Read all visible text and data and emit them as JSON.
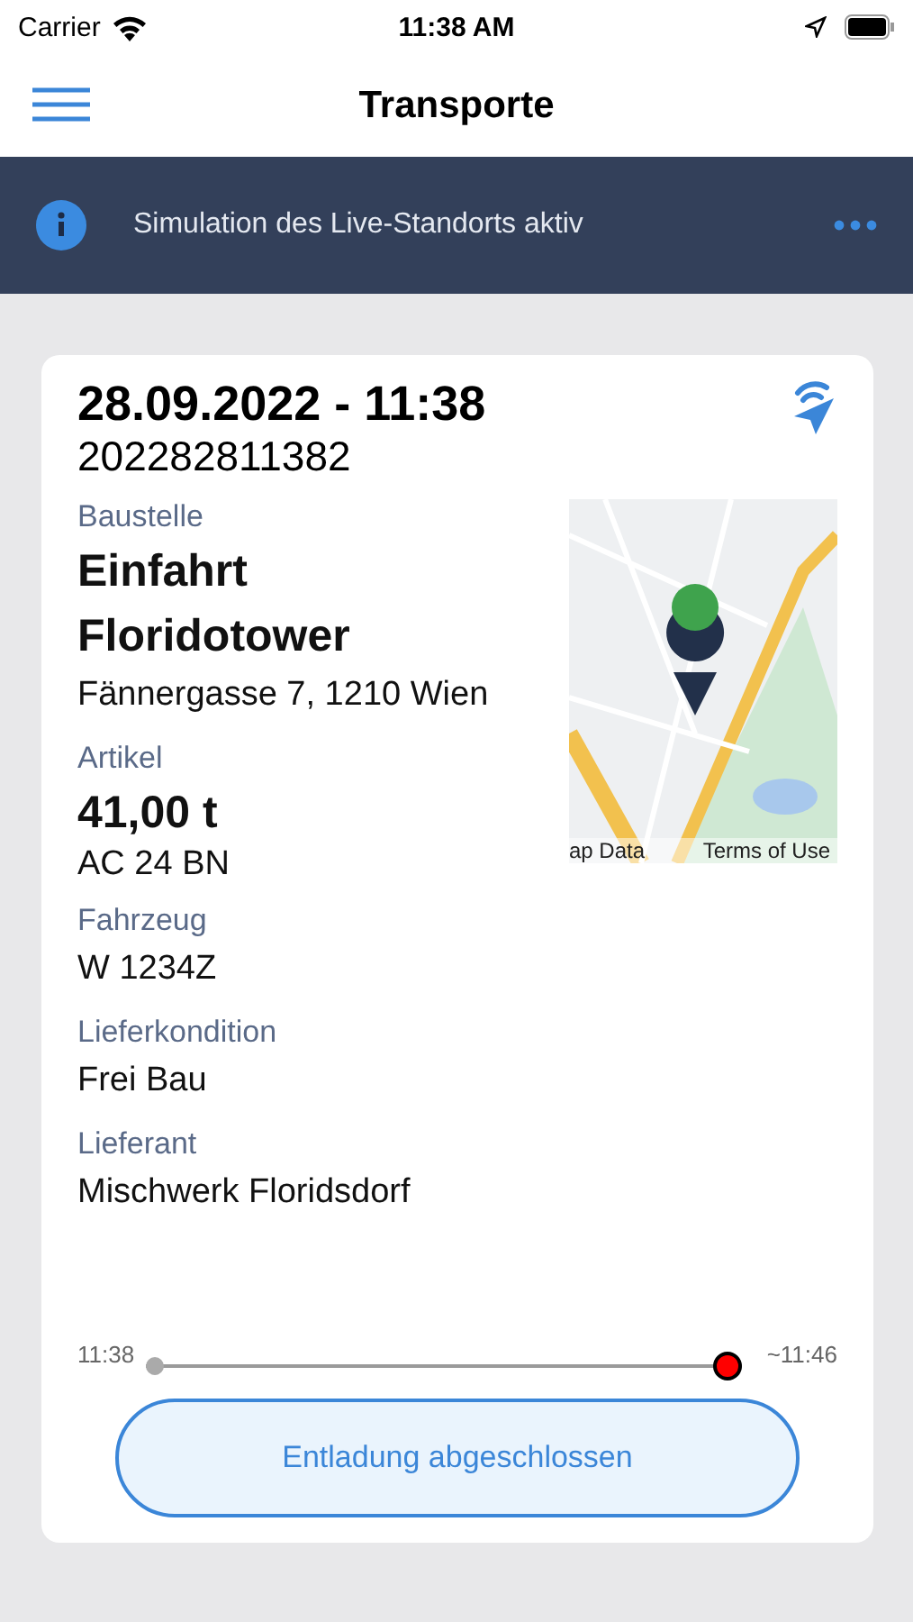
{
  "status_bar": {
    "carrier": "Carrier",
    "time": "11:38 AM"
  },
  "nav": {
    "title": "Transporte"
  },
  "banner": {
    "text": "Simulation des Live-Standorts aktiv"
  },
  "transport": {
    "datetime": "28.09.2022 - 11:38",
    "number": "202282811382",
    "site_label": "Baustelle",
    "site_name": "Einfahrt Floridotower",
    "address": "Fännergasse 7, 1210 Wien",
    "map": {
      "kind": "picture",
      "attribution": [
        "ap Data",
        "Terms of Use"
      ]
    },
    "fields": [
      {
        "label": "Artikel",
        "value": "41,00 t",
        "kind": "big",
        "sub": "AC 24 BN"
      },
      {
        "label": "Fahrzeug",
        "value": "W 1234Z",
        "kind": "plain"
      },
      {
        "label": "Lieferkondition",
        "value": "Frei Bau",
        "kind": "plain"
      },
      {
        "label": "Lieferant",
        "value": "Mischwerk Floridsdorf",
        "kind": "plain"
      }
    ],
    "progress": {
      "start": "11:38",
      "end": "~11:46",
      "level": 1
    },
    "button": "Entladung abgeschlossen"
  }
}
